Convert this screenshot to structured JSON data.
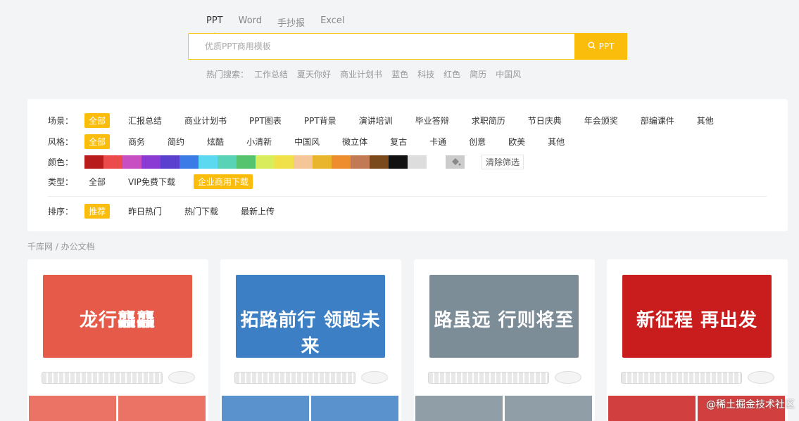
{
  "tabs": [
    "PPT",
    "Word",
    "手抄报",
    "Excel"
  ],
  "search": {
    "placeholder": "优质PPT商用模板",
    "button_label": "PPT"
  },
  "hot": {
    "label": "热门搜索：",
    "items": [
      "工作总结",
      "夏天你好",
      "商业计划书",
      "蓝色",
      "科技",
      "红色",
      "简历",
      "中国风"
    ]
  },
  "filters": {
    "scene": {
      "label": "场景：",
      "options": [
        "全部",
        "汇报总结",
        "商业计划书",
        "PPT图表",
        "PPT背景",
        "演讲培训",
        "毕业答辩",
        "求职简历",
        "节日庆典",
        "年会颁奖",
        "部编课件",
        "其他"
      ],
      "selected": 0
    },
    "style": {
      "label": "风格：",
      "options": [
        "全部",
        "商务",
        "简约",
        "炫酷",
        "小清新",
        "中国风",
        "微立体",
        "复古",
        "卡通",
        "创意",
        "欧美",
        "其他"
      ],
      "selected": 0
    },
    "color": {
      "label": "颜色：",
      "swatches": [
        "#b81c1c",
        "#ec4b4b",
        "#c84fc1",
        "#8a3bd4",
        "#5b3fcf",
        "#3a7be8",
        "#5bd9f0",
        "#58d3b5",
        "#56c46e",
        "#d9ec5b",
        "#f0e04a",
        "#f5c697",
        "#e8b52d",
        "#ee8d2d",
        "#c27a55",
        "#7a4a1c",
        "#111111",
        "#dddddd",
        "#ffffff",
        "#cccccc"
      ],
      "clear_label": "清除筛选"
    },
    "type": {
      "label": "类型：",
      "options": [
        "全部",
        "VIP免费下载",
        "企业商用下载"
      ],
      "selected": 2
    },
    "sort": {
      "label": "排序：",
      "options": [
        "推荐",
        "昨日热门",
        "热门下载",
        "最新上传"
      ],
      "selected": 0
    }
  },
  "breadcrumb": "千库网 / 办公文档",
  "cards": [
    {
      "title": "龙行龘龘",
      "bg": "#e65a4a"
    },
    {
      "title": "拓路前行 领跑未来",
      "bg": "#3d7fc4"
    },
    {
      "title": "路虽远 行则将至",
      "bg": "#7d8d98"
    },
    {
      "title": "新征程 再出发",
      "bg": "#c91d1d"
    }
  ],
  "watermark": "@稀土掘金技术社区"
}
